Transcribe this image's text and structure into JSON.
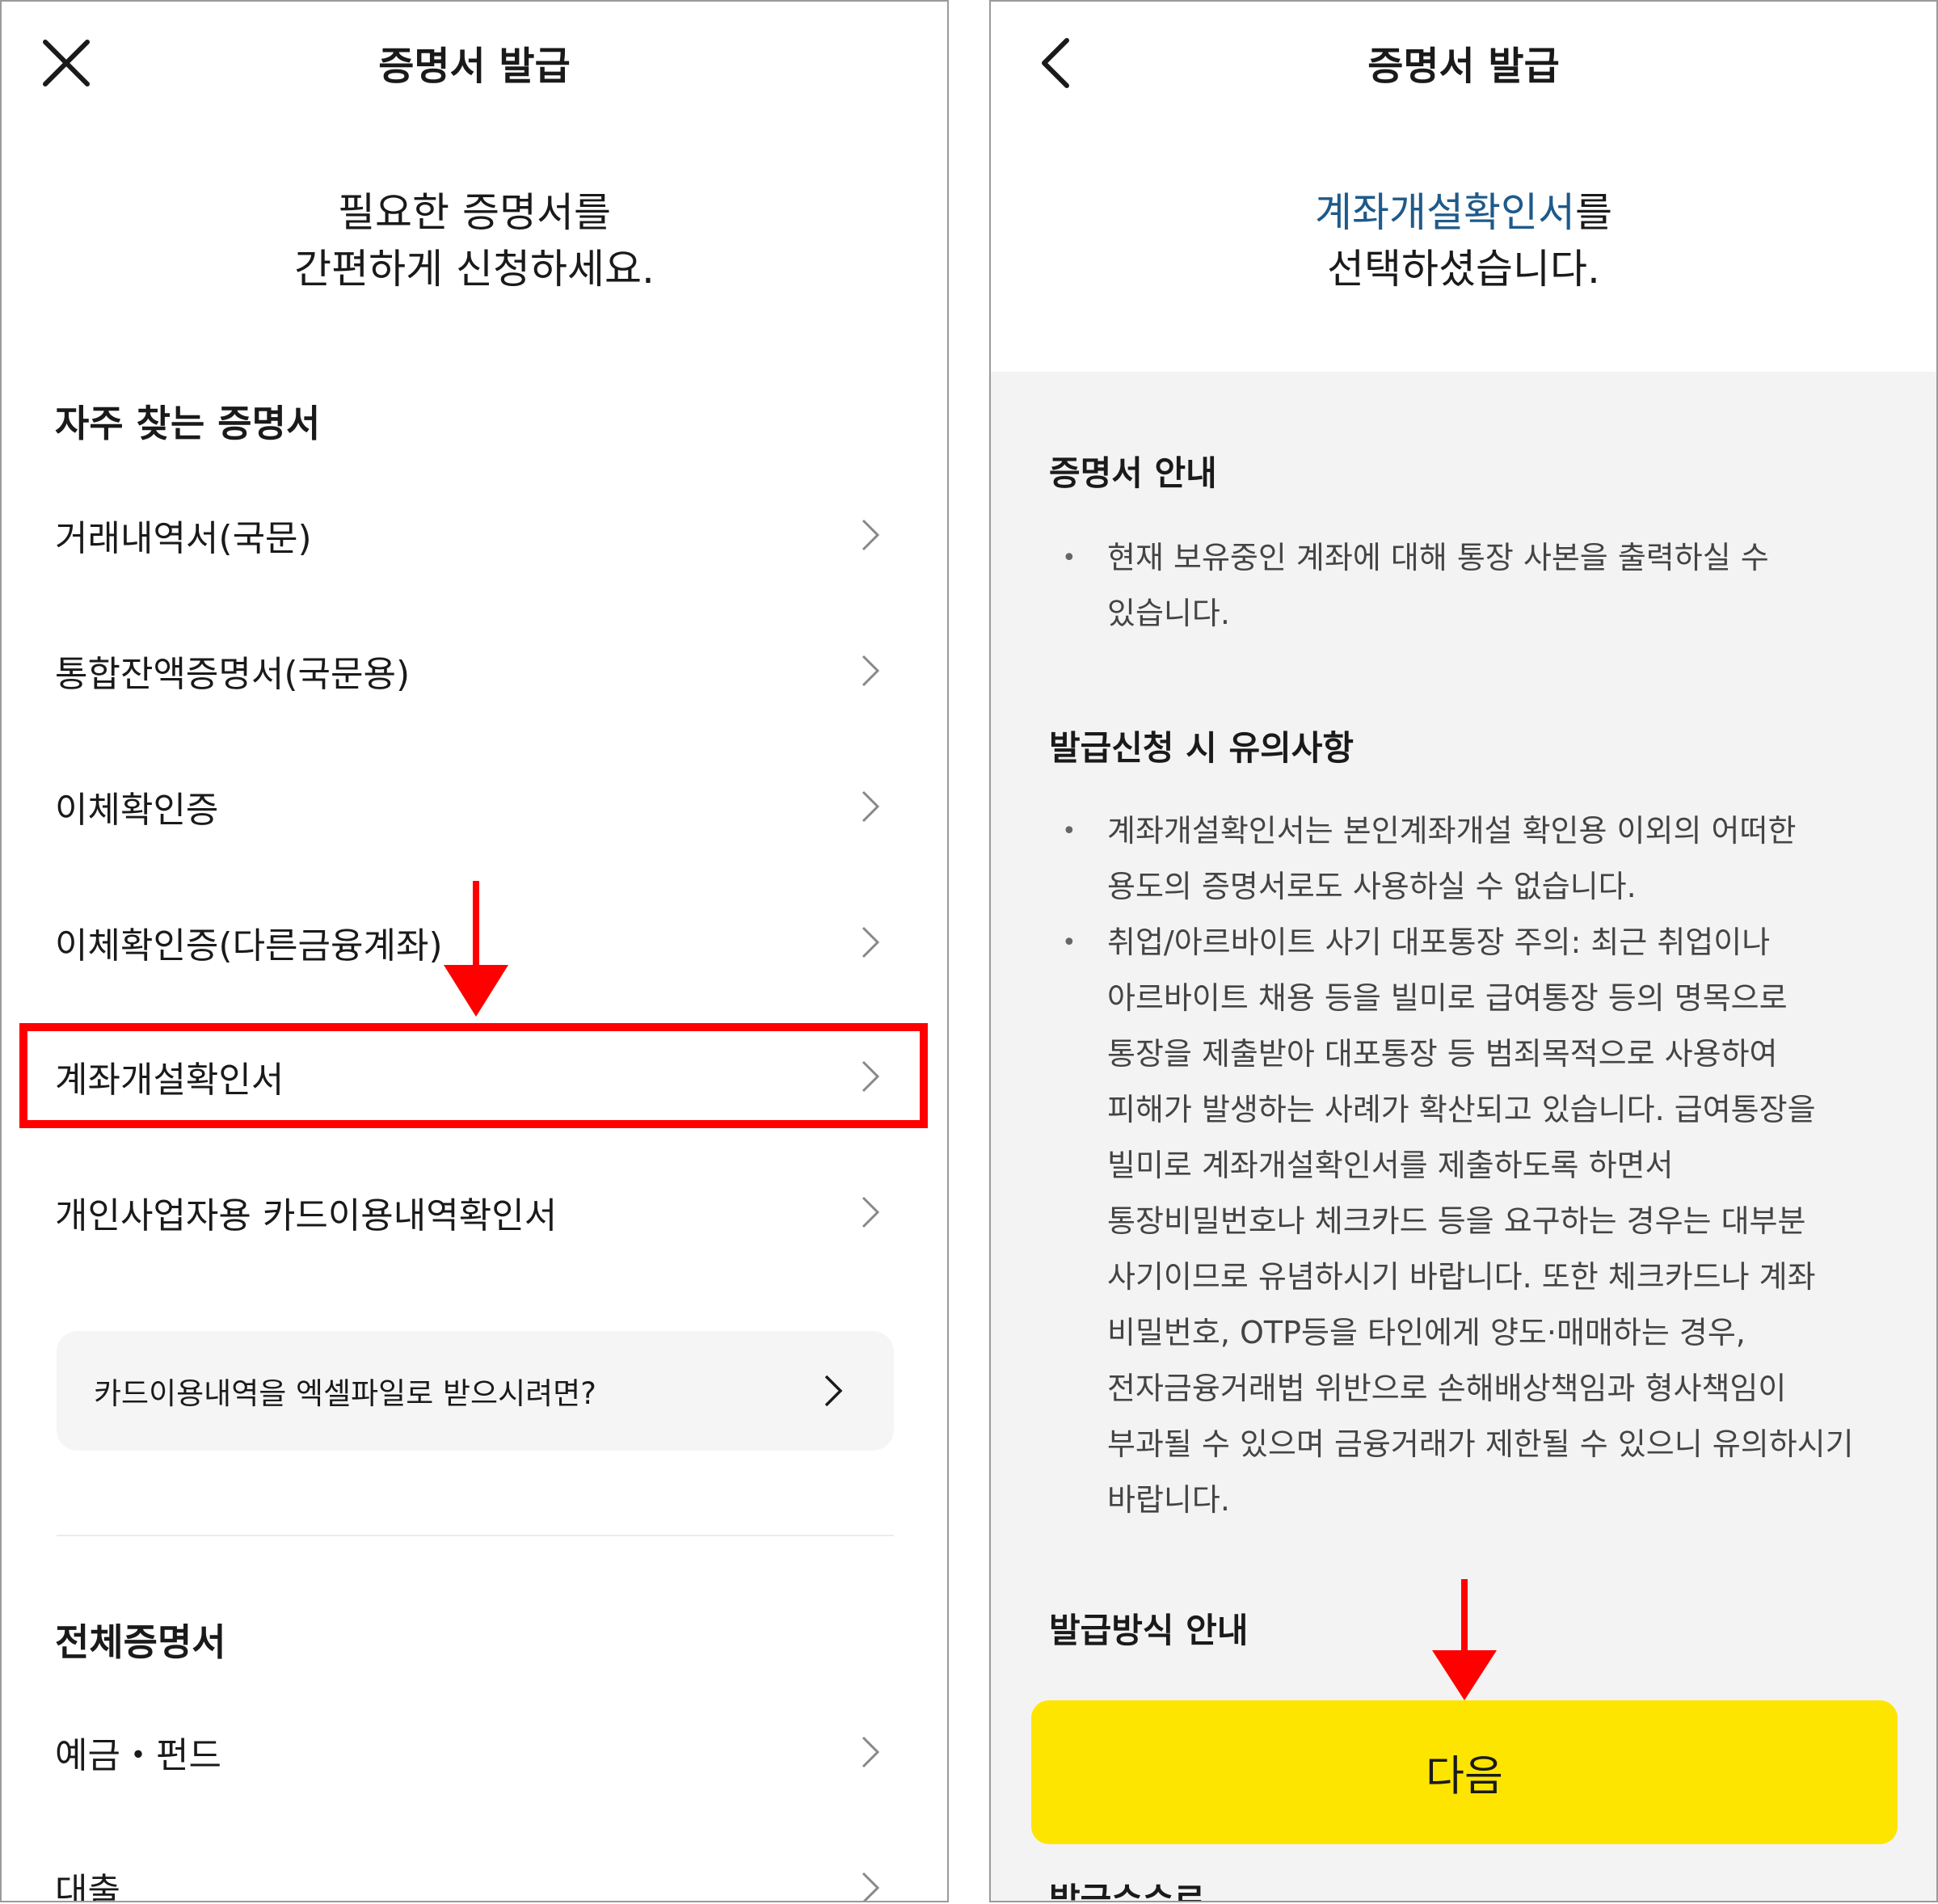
{
  "left": {
    "title": "증명서 발급",
    "hero": [
      "필요한 증명서를",
      "간편하게 신청하세요."
    ],
    "frequent_title": "자주 찾는 증명서",
    "frequent_items": [
      "거래내역서(국문)",
      "통합잔액증명서(국문용)",
      "이체확인증",
      "이체확인증(다른금융계좌)",
      "계좌개설확인서",
      "개인사업자용 카드이용내역확인서"
    ],
    "excel_card": "카드이용내역을 엑셀파일로 받으시려면?",
    "all_title": "전체증명서",
    "all_items": [
      "예금・펀드",
      "대출"
    ]
  },
  "right": {
    "title": "증명서 발급",
    "hero_accent": "계좌개설확인서",
    "hero_suffix": "를",
    "hero_line2": "선택하셨습니다.",
    "guide_title": "증명서 안내",
    "guide_bullets": [
      [
        "현재 보유중인 계좌에 대해 통장 사본을 출력하실 수",
        "있습니다."
      ]
    ],
    "caution_title": "발급신청 시 유의사항",
    "caution_bullets": [
      [
        "계좌개설확인서는 본인계좌개설 확인용 이외의 어떠한",
        "용도의 증명서로도 사용하실 수 없습니다."
      ],
      [
        "취업/아르바이트 사기 대포통장 주의: 최근 취업이나",
        "아르바이트 채용 등을 빌미로 급여통장 등의 명목으로",
        "통장을 제출받아 대포통장 등 범죄목적으로 사용하여",
        "피해가 발생하는 사례가 확산되고 있습니다. 급여통장을",
        "빌미로 계좌개설확인서를 제출하도록 하면서",
        "통장비밀번호나 체크카드 등을 요구하는 경우는 대부분",
        "사기이므로 유념하시기 바랍니다. 또한 체크카드나 계좌",
        "비밀번호, OTP등을 타인에게 양도·매매하는 경우,",
        "전자금융거래법 위반으로 손해배상책임과 형사책임이",
        "부과될 수 있으며 금융거래가 제한될 수 있으니 유의하시기",
        "바랍니다."
      ]
    ],
    "method_title": "발급방식 안내",
    "next_button": "다음",
    "cut_title": "발급수수료"
  },
  "colors": {
    "highlight": "#ff0000",
    "button": "#fee500",
    "accent_text": "#1e5a8a",
    "gray_bg": "#f3f3f3"
  },
  "icons": {
    "close": "close-icon",
    "back": "back-icon",
    "row": "chevron-right-icon",
    "annotation": "red-arrow-down-icon"
  }
}
